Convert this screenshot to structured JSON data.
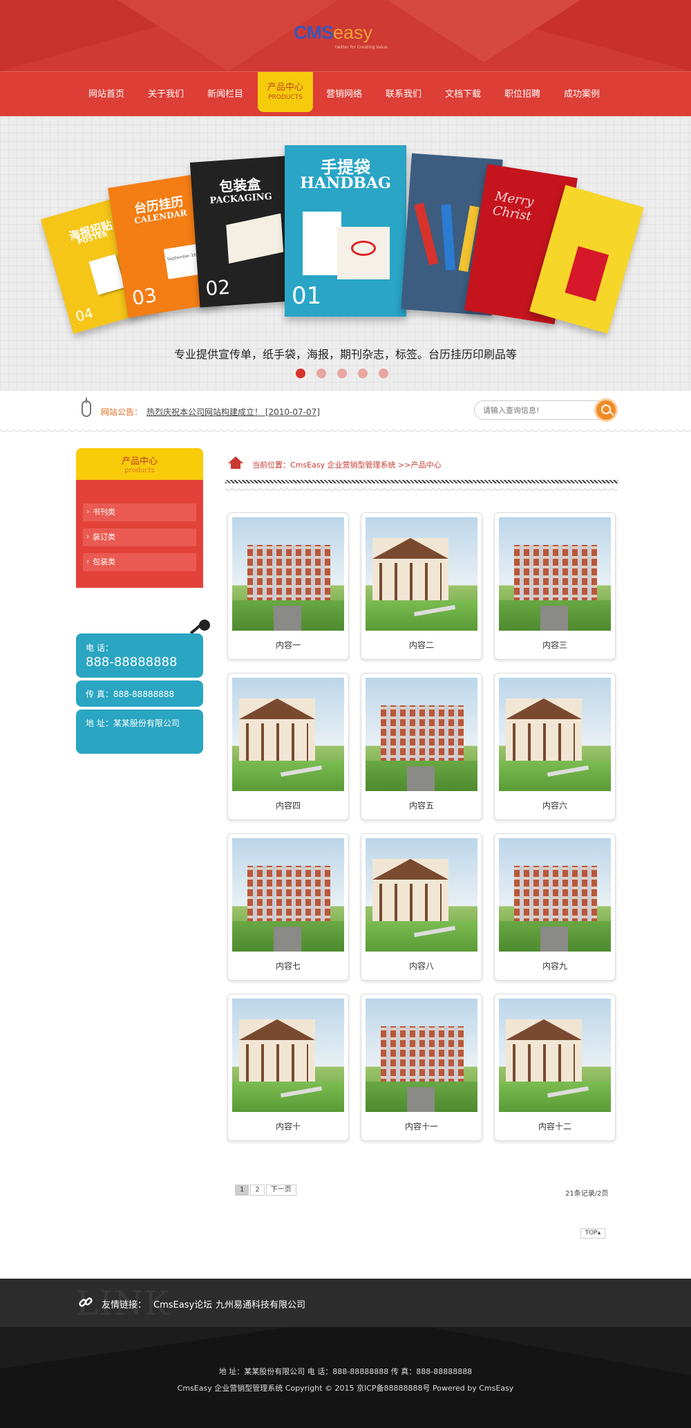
{
  "logo": {
    "cms": "CMS",
    "easy": "easy",
    "slogan": "twitter for Creating Value"
  },
  "nav": {
    "items": [
      "网站首页",
      "关于我们",
      "新闻栏目",
      "营销网络",
      "联系我们",
      "文档下载",
      "职位招聘",
      "成功案例"
    ],
    "active": {
      "label": "产品中心",
      "sub": "PRODUCTS"
    }
  },
  "banner": {
    "cards": [
      {
        "cn": "海报招贴",
        "en": "POSTER",
        "num": "04",
        "color": "#f5c518"
      },
      {
        "cn": "台历挂历",
        "en": "CALENDAR",
        "num": "03",
        "color": "#f47d14"
      },
      {
        "cn": "包装盒",
        "en": "PACKAGING",
        "num": "02",
        "color": "#222222"
      },
      {
        "cn": "手提袋",
        "en": "HANDBAG",
        "num": "01",
        "color": "#2aa5c6"
      }
    ],
    "calendar_text": "September 16",
    "card_text": "Merry Christ",
    "caption": "专业提供宣传单，纸手袋，海报，期刊杂志，标签。台历挂历印刷品等"
  },
  "notice": {
    "label": "网站公告：",
    "text": "热烈庆祝本公司网站构建成立！ [2010-07-07]"
  },
  "search": {
    "placeholder": "请输入查询信息!"
  },
  "sidebar": {
    "title": "产品中心",
    "subtitle": "products",
    "items": [
      "书刊类",
      "装订类",
      "包装类"
    ]
  },
  "contact": {
    "tel_label": "电 话：",
    "tel": "888-88888888",
    "fax": "传 真：888-88888888",
    "addr": "地 址：某某股份有限公司"
  },
  "breadcrumb": "当前位置：CmsEasy 企业营销型管理系统 >>产品中心",
  "products": [
    "内容一",
    "内容二",
    "内容三",
    "内容四",
    "内容五",
    "内容六",
    "内容七",
    "内容八",
    "内容九",
    "内容十",
    "内容十一",
    "内容十二"
  ],
  "pager": {
    "pages": [
      "1",
      "2"
    ],
    "next": "下一页",
    "total": "21条记录/2页",
    "top": "TOP"
  },
  "links": {
    "bg": "LINK",
    "label": "友情链接：",
    "items": [
      "CmsEasy论坛",
      "九州易通科技有限公司"
    ]
  },
  "footer": {
    "line1": "地 址：某某股份有限公司 电 话：888-88888888 传 真：888-88888888",
    "line2": "CmsEasy 企业营销型管理系统 Copyright © 2015 京ICP备88888888号 Powered by CmsEasy"
  },
  "colors": {
    "brand_red": "#dd3e36",
    "accent_yellow": "#f5cb0c",
    "contact_blue": "#2aa5c2"
  }
}
